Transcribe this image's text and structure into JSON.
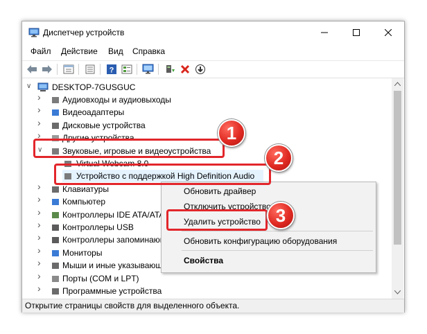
{
  "window": {
    "title": "Диспетчер устройств",
    "icon": "device-manager-icon"
  },
  "menu": [
    "Файл",
    "Действие",
    "Вид",
    "Справка"
  ],
  "toolbar": {
    "icons": [
      "back-arrow-icon",
      "forward-arrow-icon",
      "properties-icon",
      "device-list-icon",
      "help-icon",
      "view-icon",
      "monitor-icon",
      "update-driver-icon",
      "uninstall-icon",
      "download-icon"
    ]
  },
  "tree": {
    "root": "DESKTOP-7GUSGUC",
    "items": [
      {
        "label": "Аудиовходы и аудиовыходы",
        "expanded": false
      },
      {
        "label": "Видеоадаптеры",
        "expanded": false
      },
      {
        "label": "Дисковые устройства",
        "expanded": false
      },
      {
        "label": "Другие устройства",
        "expanded": false
      },
      {
        "label": "Звуковые, игровые и видеоустройства",
        "expanded": true
      },
      {
        "label": "Virtual Webcam 8.0",
        "child": true
      },
      {
        "label": "Устройство с поддержкой High Definition Audio",
        "child": true,
        "selected": true
      },
      {
        "label": "Клавиатуры",
        "expanded": false
      },
      {
        "label": "Компьютер",
        "expanded": false
      },
      {
        "label": "Контроллеры IDE ATA/ATAPI",
        "expanded": false
      },
      {
        "label": "Контроллеры USB",
        "expanded": false
      },
      {
        "label": "Контроллеры запоминающих устройств",
        "expanded": false
      },
      {
        "label": "Мониторы",
        "expanded": false
      },
      {
        "label": "Мыши и иные указывающие устройства",
        "expanded": false
      },
      {
        "label": "Порты (COM и LPT)",
        "expanded": false
      },
      {
        "label": "Программные устройства",
        "expanded": false
      }
    ]
  },
  "context_menu": {
    "items": [
      "Обновить драйвер",
      "Отключить устройство",
      "Удалить устройство",
      "Обновить конфигурацию оборудования",
      "Свойства"
    ]
  },
  "badges": [
    "1",
    "2",
    "3"
  ],
  "status": "Открытие страницы свойств для выделенного объекта.",
  "colors": {
    "highlight": "#e2262b",
    "selection": "#e5f3ff"
  }
}
